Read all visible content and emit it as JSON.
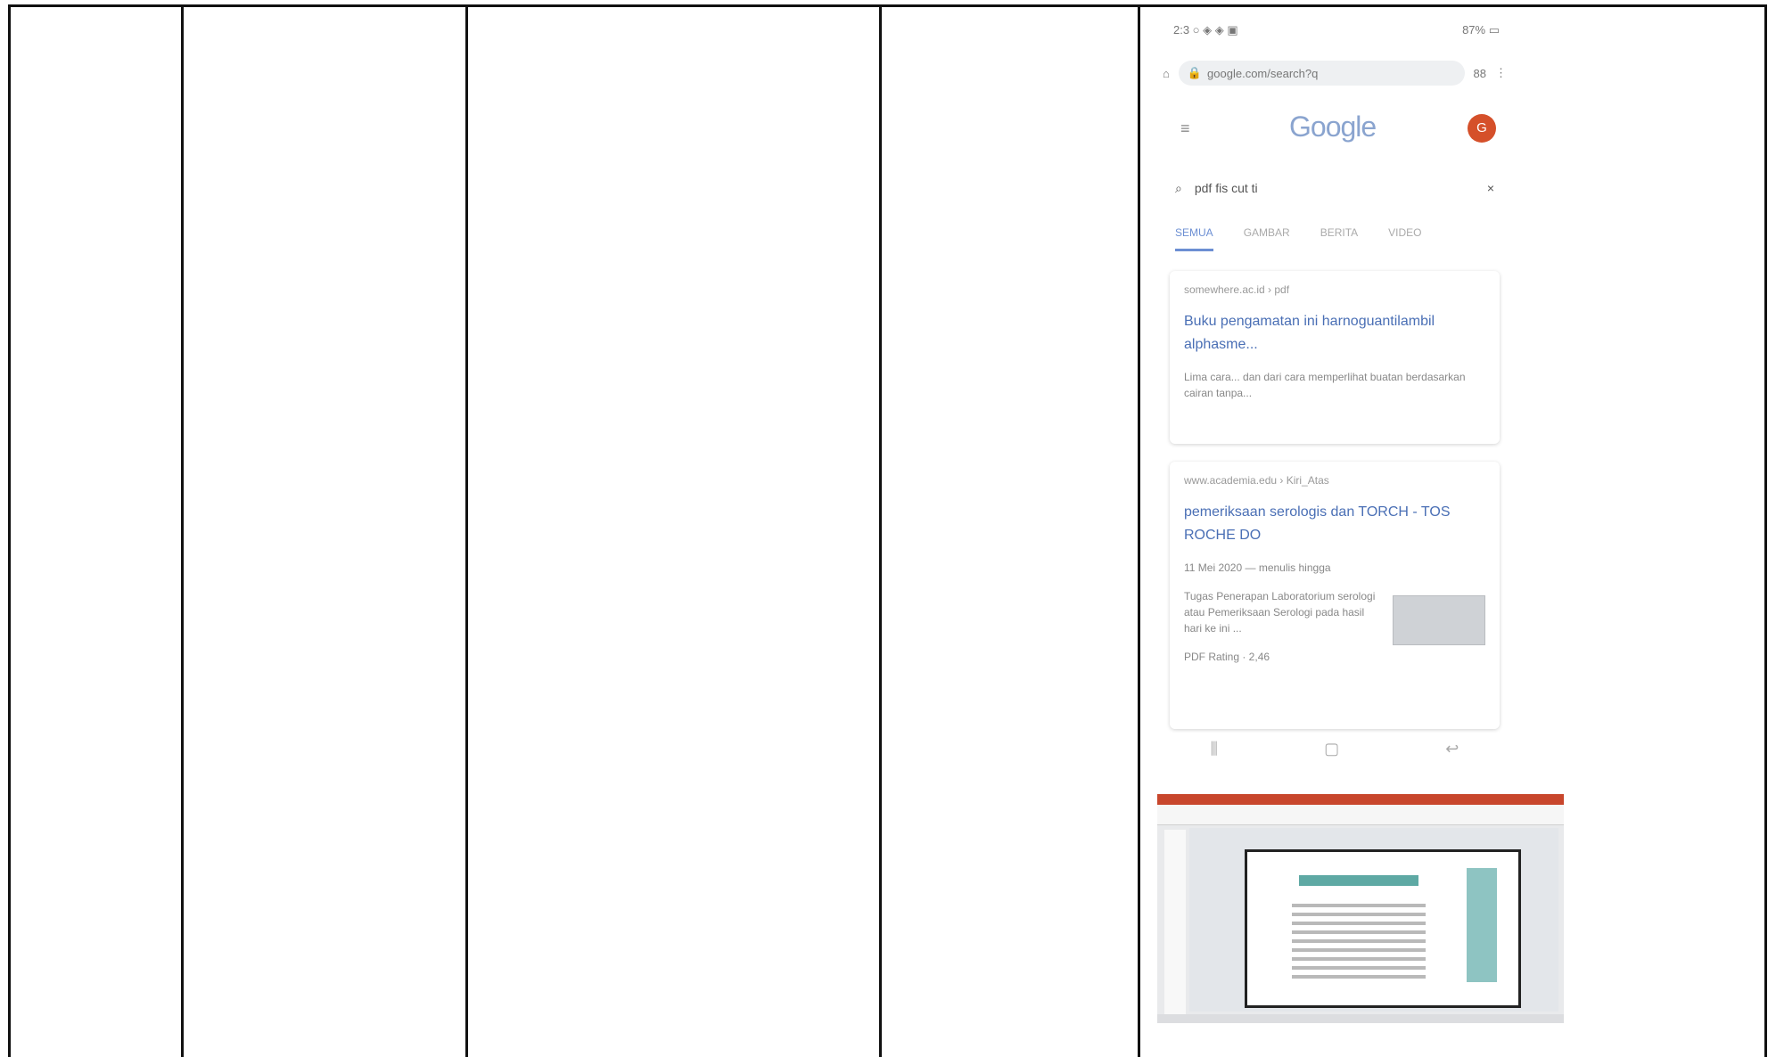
{
  "phone": {
    "status_left": "2:3 ○ ◈ ◈ ▣",
    "status_right": "87% ▭",
    "url": "google.com/search?q",
    "tab_count": "88",
    "logo": "Google",
    "avatar": "G",
    "search_query": "pdf fis cut ti",
    "tabs": [
      "SEMUA",
      "GAMBAR",
      "BERITA",
      "VIDEO"
    ],
    "results": [
      {
        "site": "somewhere.ac.id › pdf",
        "title": "Buku pengamatan ini harnoguantilambil alphasme...",
        "snippet": "Lima cara... dan dari cara memperlihat buatan berdasarkan cairan tanpa..."
      },
      {
        "site": "www.academia.edu › Kiri_Atas",
        "title": "pemeriksaan serologis dan TORCH - TOS ROCHE DO",
        "snippet": "Tugas Penerapan Laboratorium serologi atau Pemeriksaan Serologi pada hasil hari ke ini ...",
        "meta": "11 Mei 2020 — menulis hingga",
        "footer": "PDF Rating · 2,46"
      }
    ]
  }
}
